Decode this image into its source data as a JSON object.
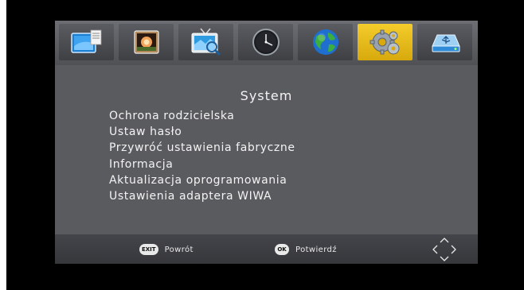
{
  "menu": {
    "title": "System",
    "items": [
      "Ochrona rodzicielska",
      "Ustaw hasło",
      "Przywróć ustawienia fabryczne",
      "Informacja",
      "Aktualizacja oprogramowania",
      "Ustawienia adaptera WIWA"
    ]
  },
  "icon_bar": {
    "tiles": [
      {
        "icon": "program-manager-icon",
        "active": false
      },
      {
        "icon": "picture-icon",
        "active": false
      },
      {
        "icon": "channel-search-icon",
        "active": false
      },
      {
        "icon": "clock-icon",
        "active": false
      },
      {
        "icon": "globe-language-icon",
        "active": false
      },
      {
        "icon": "gears-system-icon",
        "active": true
      },
      {
        "icon": "usb-storage-icon",
        "active": false
      }
    ],
    "active_color": "#f0c420"
  },
  "footer": {
    "exit_key": "EXIT",
    "exit_label": "Powrót",
    "ok_key": "OK",
    "ok_label": "Potwierdź",
    "nav_icon": "navigation-arrows-icon"
  }
}
